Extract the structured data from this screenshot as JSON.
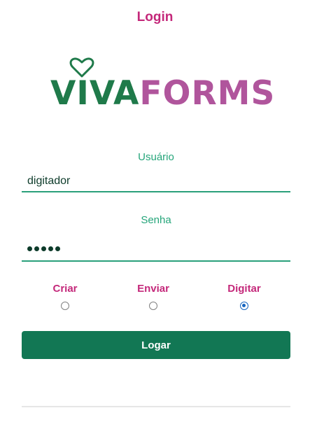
{
  "header": {
    "title": "Login"
  },
  "logo": {
    "part1": "VIVA",
    "part2": "FORMS",
    "color_part1": "#1f7a4a",
    "color_part2": "#b0559c",
    "icon": "heart-icon"
  },
  "form": {
    "username": {
      "label": "Usuário",
      "value": "digitador"
    },
    "password": {
      "label": "Senha",
      "masked_length": 5
    },
    "mode_options": [
      {
        "label": "Criar",
        "selected": false
      },
      {
        "label": "Enviar",
        "selected": false
      },
      {
        "label": "Digitar",
        "selected": true
      }
    ],
    "submit_label": "Logar"
  },
  "colors": {
    "accent": "#c4287a",
    "primary": "#127754",
    "field_line": "#2aa07b",
    "radio_selected": "#1565c0"
  }
}
